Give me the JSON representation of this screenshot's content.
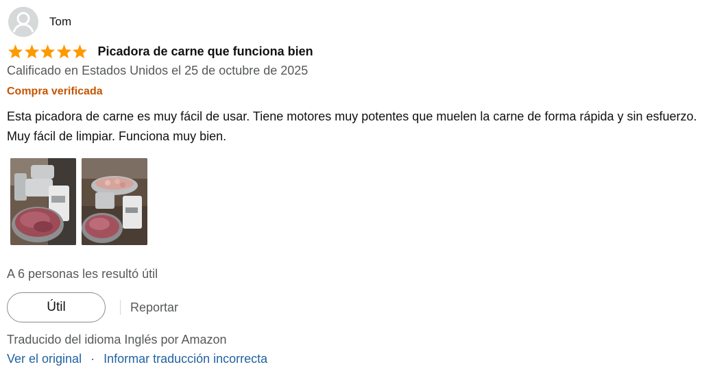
{
  "reviewer": {
    "name": "Tom",
    "avatar_icon": "person-icon"
  },
  "review": {
    "rating": 5,
    "rating_max": 5,
    "star_color": "#ff9900",
    "title": "Picadora de carne que funciona bien",
    "meta": "Calificado en Estados Unidos el 25 de octubre de 2025",
    "verified": "Compra verificada",
    "body": "Esta picadora de carne es muy fácil de usar. Tiene motores muy potentes que muelen la carne de forma rápida y sin esfuerzo. Muy fácil de limpiar. Funciona muy bien."
  },
  "photos": [
    {
      "name": "review-photo-1"
    },
    {
      "name": "review-photo-2"
    }
  ],
  "helpful": {
    "count_text": "A 6 personas les resultó útil",
    "button_label": "Útil",
    "report_label": "Reportar"
  },
  "translation": {
    "notice": "Traducido del idioma Inglés por Amazon",
    "view_original": "Ver el original",
    "separator": "·",
    "report_translation": "Informar traducción incorrecta"
  },
  "colors": {
    "verified": "#c45500",
    "link": "#2162a1",
    "secondary_text": "#565959"
  }
}
